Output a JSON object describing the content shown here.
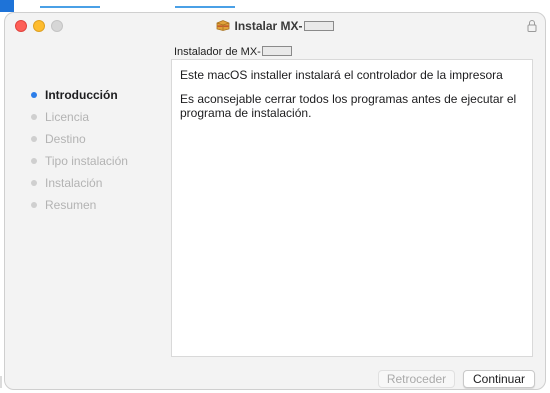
{
  "window": {
    "title": "Instalar MX-",
    "title_icon": "package-icon",
    "lock_icon": "lock-icon"
  },
  "subtitle": "Instalador de MX-",
  "steps": [
    {
      "label": "Introducción",
      "active": true
    },
    {
      "label": "Licencia",
      "active": false
    },
    {
      "label": "Destino",
      "active": false
    },
    {
      "label": "Tipo instalación",
      "active": false
    },
    {
      "label": "Instalación",
      "active": false
    },
    {
      "label": "Resumen",
      "active": false
    }
  ],
  "content": {
    "paragraph1": "Este macOS installer instalará el controlador de la impresora",
    "paragraph2": "Es aconsejable cerrar todos los programas antes de ejecutar el programa de instalación."
  },
  "buttons": {
    "back": "Retroceder",
    "continue": "Continuar"
  },
  "colors": {
    "active_step": "#2b7de9",
    "close": "#fe5f57",
    "minimize": "#febc2e"
  }
}
